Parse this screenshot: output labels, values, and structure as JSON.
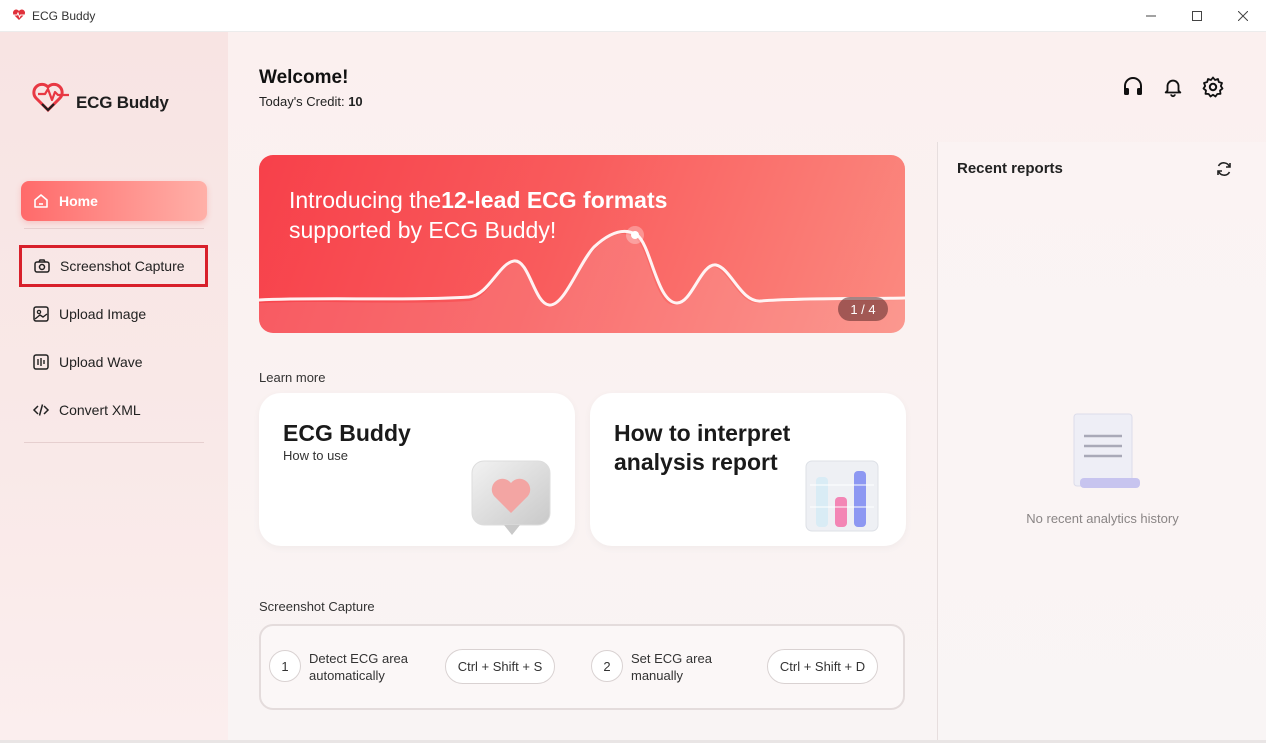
{
  "window": {
    "title": "ECG Buddy",
    "controls": {
      "minimize": "—",
      "maximize": "☐",
      "close": "✕"
    }
  },
  "sidebar": {
    "logo_text": "ECG Buddy",
    "items": [
      {
        "label": "Home",
        "icon": "home-icon",
        "active": true
      },
      {
        "label": "Screenshot Capture",
        "icon": "camera-icon",
        "highlighted": true
      },
      {
        "label": "Upload Image",
        "icon": "image-icon"
      },
      {
        "label": "Upload Wave",
        "icon": "wave-icon"
      },
      {
        "label": "Convert XML",
        "icon": "code-icon"
      }
    ]
  },
  "header": {
    "welcome": "Welcome!",
    "credit_label": "Today's Credit:",
    "credit_value": "10",
    "icons": [
      "headset-icon",
      "bell-icon",
      "gear-icon"
    ]
  },
  "banner": {
    "line1_prefix": "Introducing the",
    "line1_bold": "12-lead ECG formats",
    "line2": "supported by ECG Buddy!",
    "page_indicator": "1 / 4"
  },
  "learn_more": {
    "label": "Learn more",
    "cards": [
      {
        "title": "ECG Buddy",
        "subtitle": "How to use"
      },
      {
        "title_line1": "How to interpret",
        "title_line2": "analysis report"
      }
    ]
  },
  "screenshot_capture": {
    "label": "Screenshot Capture",
    "steps": [
      {
        "number": "1",
        "line1": "Detect ECG area",
        "line2": "automatically",
        "shortcut": "Ctrl + Shift + S"
      },
      {
        "number": "2",
        "line1": "Set ECG area",
        "line2": "manually",
        "shortcut": "Ctrl + Shift + D"
      }
    ]
  },
  "recent_reports": {
    "title": "Recent reports",
    "empty_text": "No recent analytics history"
  },
  "colors": {
    "accent": "#f7404a",
    "highlight_border": "#d8202b",
    "sidebar_bg": "#f8e4e3"
  }
}
